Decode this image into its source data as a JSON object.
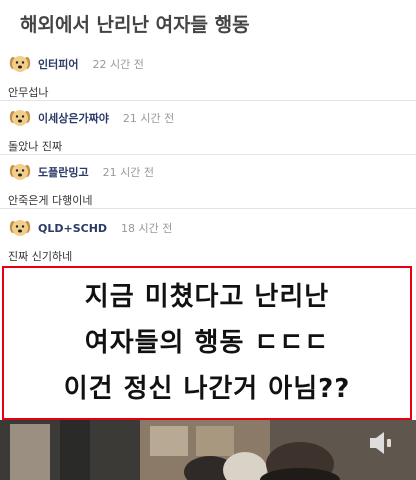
{
  "title": "해외에서 난리난 여자들 행동",
  "comments": [
    {
      "user": "인터피어",
      "time": "22 시간 전",
      "text": "안무섭나"
    },
    {
      "user": "이세상은가짜야",
      "time": "21 시간 전",
      "text": "돌았나 진짜"
    },
    {
      "user": "도플란밍고",
      "time": "21 시간 전",
      "text": "안죽은게 다행이네"
    },
    {
      "user": "QLD+SCHD",
      "time": "18 시간 전",
      "text": "진짜 신기하네"
    }
  ],
  "banner": {
    "line1": "지금 미쳤다고 난리난",
    "line2": "여자들의 행동 ㄷㄷㄷ",
    "line3": "이건 정신 나간거 아님??"
  },
  "colors": {
    "banner_border": "#e60012",
    "username": "#2b3a67"
  },
  "icons": {
    "avatar": "dog-avatar-icon",
    "speaker": "speaker-icon"
  }
}
